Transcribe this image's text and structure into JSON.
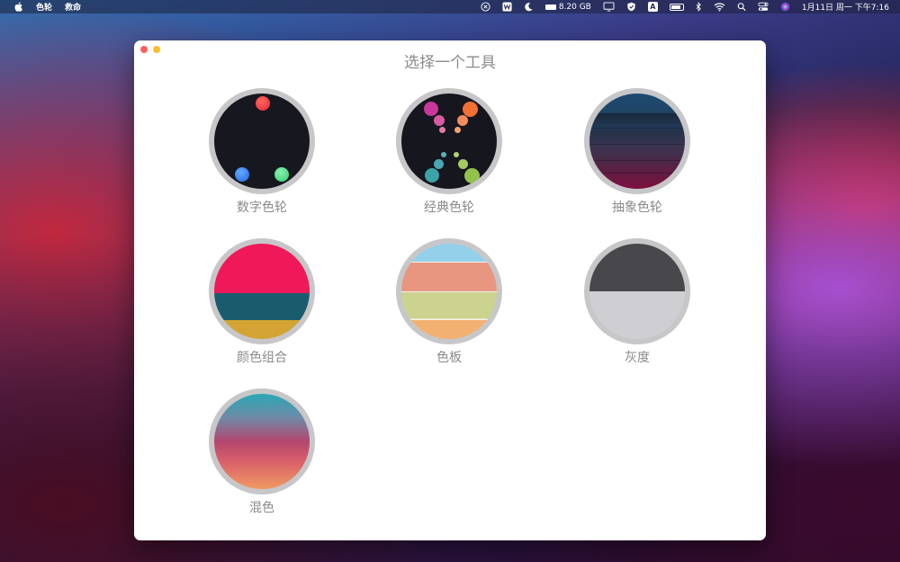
{
  "menubar": {
    "app_name": "色轮",
    "menu_help": "救命",
    "memory": "8.20 GB",
    "input_method": "A",
    "clock": "1月11日 周一 下午7:16"
  },
  "window": {
    "title": "选择一个工具"
  },
  "tools": [
    {
      "label": "数字色轮",
      "icon": "digital-wheel"
    },
    {
      "label": "经典色轮",
      "icon": "classic-wheel"
    },
    {
      "label": "抽象色轮",
      "icon": "abstract-wheel"
    },
    {
      "label": "颜色组合",
      "icon": "color-combination"
    },
    {
      "label": "色板",
      "icon": "palette"
    },
    {
      "label": "灰度",
      "icon": "grayscale"
    },
    {
      "label": "混色",
      "icon": "blend"
    }
  ]
}
